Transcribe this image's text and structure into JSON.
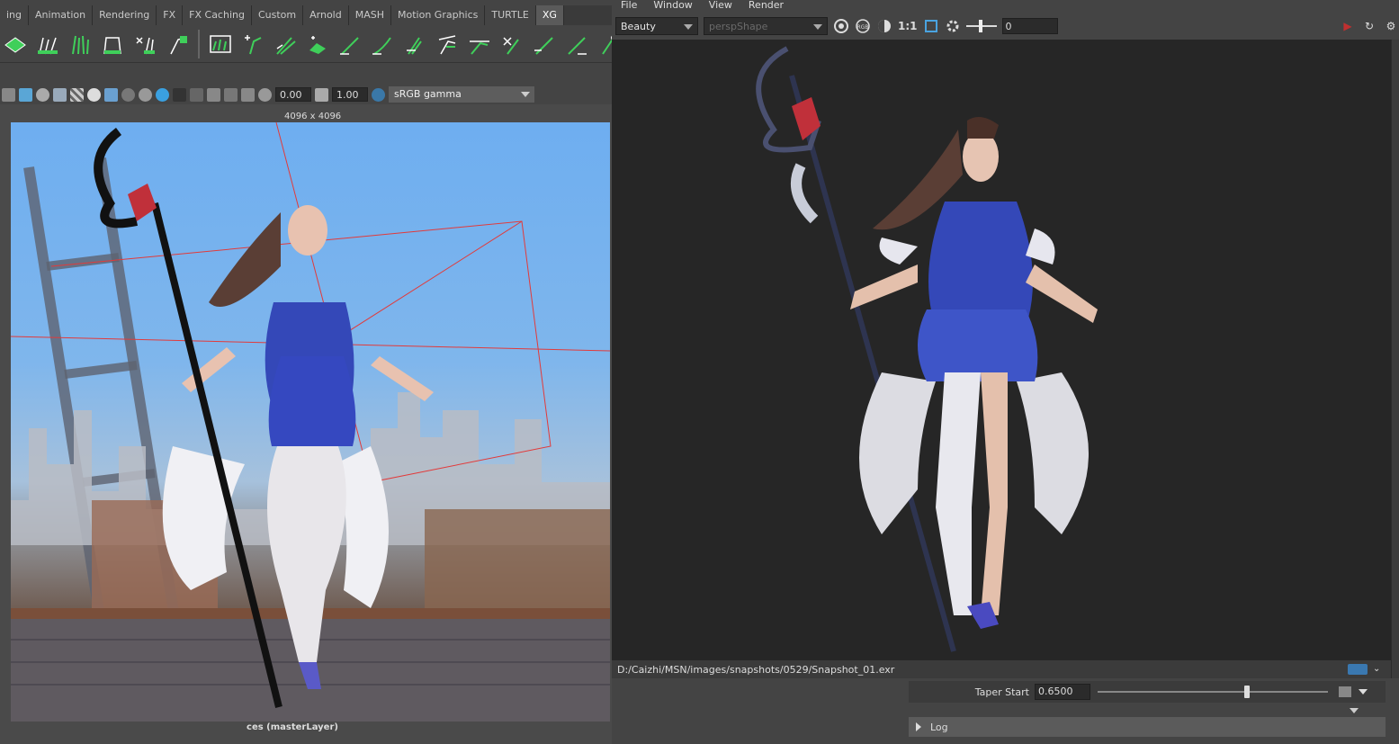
{
  "main_window": {
    "shelf_tabs": [
      {
        "label": "ing"
      },
      {
        "label": "Animation"
      },
      {
        "label": "Rendering"
      },
      {
        "label": "FX"
      },
      {
        "label": "FX Caching"
      },
      {
        "label": "Custom"
      },
      {
        "label": "Arnold"
      },
      {
        "label": "MASH"
      },
      {
        "label": "Motion Graphics"
      },
      {
        "label": "TURTLE"
      },
      {
        "label": "XG"
      }
    ],
    "active_shelf_tab": "XG",
    "viewport_toolbar": {
      "exposure_value": "0.00",
      "gamma_value": "1.00",
      "color_space": "sRGB gamma"
    },
    "viewport": {
      "resolution_gate_label": "4096 x 4096",
      "camera_label": "ces (masterLayer)"
    }
  },
  "render_view": {
    "menu": [
      {
        "label": "File"
      },
      {
        "label": "Window"
      },
      {
        "label": "View"
      },
      {
        "label": "Render"
      }
    ],
    "toolbar": {
      "aov_dropdown": "Beauty",
      "camera_dropdown": "perspShape",
      "ratio_label": "1:1",
      "exposure_field": "0"
    },
    "status_filepath": "D:/Caizhi/MSN/images/snapshots/0529/Snapshot_01.exr"
  },
  "attribute_editor": {
    "taper_start_label": "Taper Start",
    "taper_start_value": "0.6500",
    "taper_start_fraction": 0.65,
    "log_label": "Log"
  },
  "colors": {
    "shelf_icon_green": "#3fcf5a",
    "render_background": "#262626",
    "dress_blue": "#3448b8",
    "gem_red": "#c0303a",
    "gate_line_red": "#e23a3a"
  }
}
